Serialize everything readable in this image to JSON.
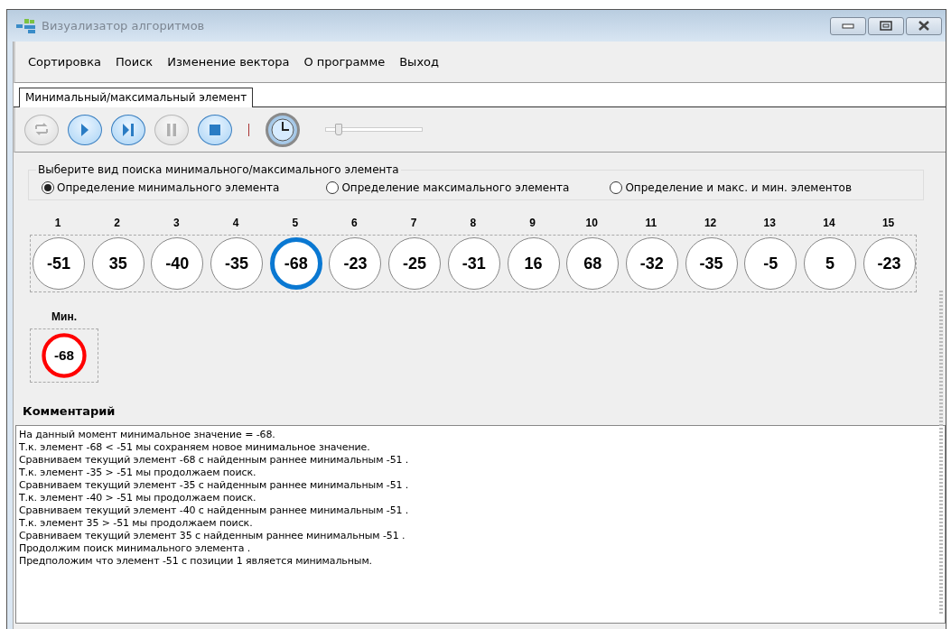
{
  "window": {
    "title": "Визуализатор алгоритмов"
  },
  "menu": [
    "Сортировка",
    "Поиск",
    "Изменение вектора",
    "О программе",
    "Выход"
  ],
  "tabs": [
    {
      "label": "Минимальный/максимальный элемент",
      "selected": true
    }
  ],
  "toolbar": [
    {
      "kind": "repeat",
      "disabled": true
    },
    {
      "kind": "play",
      "disabled": false
    },
    {
      "kind": "step",
      "disabled": false
    },
    {
      "kind": "pause",
      "disabled": true
    },
    {
      "kind": "stop",
      "disabled": false
    },
    {
      "kind": "separator"
    },
    {
      "kind": "clock"
    }
  ],
  "speed": {
    "level": 0.12
  },
  "search_mode": {
    "title": "Выберите вид поиска минимального/максимального элемента",
    "options": [
      {
        "label": "Определение минимального элемента",
        "selected": true
      },
      {
        "label": "Определение максимального элемента",
        "selected": false
      },
      {
        "label": "Определение и макс. и мин. элементов",
        "selected": false
      }
    ]
  },
  "array": [
    {
      "index": "1",
      "value": "-51",
      "selected": false
    },
    {
      "index": "2",
      "value": "35",
      "selected": false
    },
    {
      "index": "3",
      "value": "-40",
      "selected": false
    },
    {
      "index": "4",
      "value": "-35",
      "selected": false
    },
    {
      "index": "5",
      "value": "-68",
      "selected": true
    },
    {
      "index": "6",
      "value": "-23",
      "selected": false
    },
    {
      "index": "7",
      "value": "-25",
      "selected": false
    },
    {
      "index": "8",
      "value": "-31",
      "selected": false
    },
    {
      "index": "9",
      "value": "16",
      "selected": false
    },
    {
      "index": "10",
      "value": "68",
      "selected": false
    },
    {
      "index": "11",
      "value": "-32",
      "selected": false
    },
    {
      "index": "12",
      "value": "-35",
      "selected": false
    },
    {
      "index": "13",
      "value": "-5",
      "selected": false
    },
    {
      "index": "14",
      "value": "5",
      "selected": false
    },
    {
      "index": "15",
      "value": "-23",
      "selected": false
    }
  ],
  "result": {
    "label": "Мин.",
    "value": "-68"
  },
  "comment": {
    "label": "Комментарий",
    "lines": [
      "На данный момент минимальное значение = -68.",
      "Т.к. элемент -68 < -51 мы сохраняем новое минимальное значение.",
      "Сравниваем текущий элемент -68 с найденным раннее минимальным -51 .",
      "Т.к. элемент -35 > -51 мы продолжаем поиск.",
      "Сравниваем текущий элемент -35 с найденным раннее минимальным -51 .",
      "Т.к. элемент -40 > -51 мы продолжаем поиск.",
      "Сравниваем текущий элемент -40 с найденным раннее минимальным -51 .",
      "Т.к. элемент 35 > -51 мы продолжаем поиск.",
      "Сравниваем текущий элемент 35 с найденным раннее минимальным -51 .",
      "Продолжим поиск минимального элемента .",
      "Предположим что элемент -51 с позиции 1 является минимальным."
    ]
  }
}
